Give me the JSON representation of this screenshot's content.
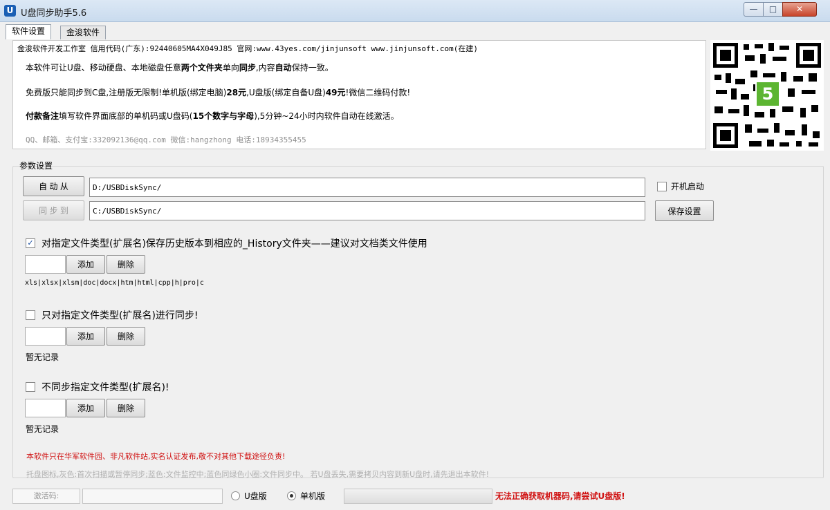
{
  "window": {
    "title": "U盘同步助手5.6",
    "icon_letter": "U",
    "min_label": "—",
    "max_label": "□",
    "close_label": "✕"
  },
  "tabs": [
    {
      "label": "软件设置"
    },
    {
      "label": "金浚软件"
    }
  ],
  "info": {
    "line0": "金浚软件开发工作室 信用代码(广东):92440605MA4X049J85 官网:www.43yes.com/jinjunsoft  www.jinjunsoft.com(在建)",
    "line1_pre": "本软件可让U盘、移动硬盘、本地磁盘任意",
    "line1_b1": "两个文件夹",
    "line1_mid": "单向",
    "line1_b2": "同步",
    "line1_mid2": ",内容",
    "line1_b3": "自动",
    "line1_post": "保持一致。",
    "line2_pre": "免费版只能同步到C盘,注册版无限制!单机版(绑定电脑)",
    "line2_b1": "28元",
    "line2_mid": ",U盘版(绑定自备U盘)",
    "line2_b2": "49元",
    "line2_post": "!微信二维码付款!",
    "line3_b1": "付款备注",
    "line3_mid": "填写软件界面底部的单机码或U盘码(",
    "line3_b2": "15个数字与字母",
    "line3_post": "),5分钟~24小时内软件自动在线激活。",
    "line4": "QQ、邮箱、支付宝:332092136@qq.com    微信:hangzhong    电话:18934355455"
  },
  "params": {
    "group_label": "参数设置",
    "from_button": "自 动 从",
    "to_button": "同 步 到",
    "from_path": "D:/USBDiskSync/",
    "to_path": "C:/USBDiskSync/",
    "autostart_label": "开机启动",
    "autostart_checked": false,
    "save_button": "保存设置"
  },
  "sections": [
    {
      "label": "对指定文件类型(扩展名)保存历史版本到相应的_History文件夹——建议对文档类文件使用",
      "checked": true,
      "add": "添加",
      "delete": "删除",
      "records": "xls|xlsx|xlsm|doc|docx|htm|html|cpp|h|pro|c"
    },
    {
      "label": "只对指定文件类型(扩展名)进行同步!",
      "checked": false,
      "add": "添加",
      "delete": "删除",
      "records": "暂无记录"
    },
    {
      "label": "不同步指定文件类型(扩展名)!",
      "checked": false,
      "add": "添加",
      "delete": "删除",
      "records": "暂无记录"
    }
  ],
  "warning": "本软件只在华军软件园、非凡软件站,实名认证发布,敬不对其他下载途径负责!",
  "tray_hint": "托盘图标,灰色:首次扫描或暂停同步;蓝色:文件监控中;蓝色同绿色小圈:文件同步中。 若U盘丢失,需要拷贝内容到新U盘时,请先退出本软件!",
  "status": {
    "activation_placeholder": "激活码:",
    "radio_udisk": "U盘版",
    "radio_single": "单机版",
    "selected": "单机版",
    "error": "无法正确获取机器码,请尝试U盘版!"
  },
  "colors": {
    "warning": "#d01010",
    "hint": "#b0b0b0",
    "titlebar": "#c9dbee"
  }
}
